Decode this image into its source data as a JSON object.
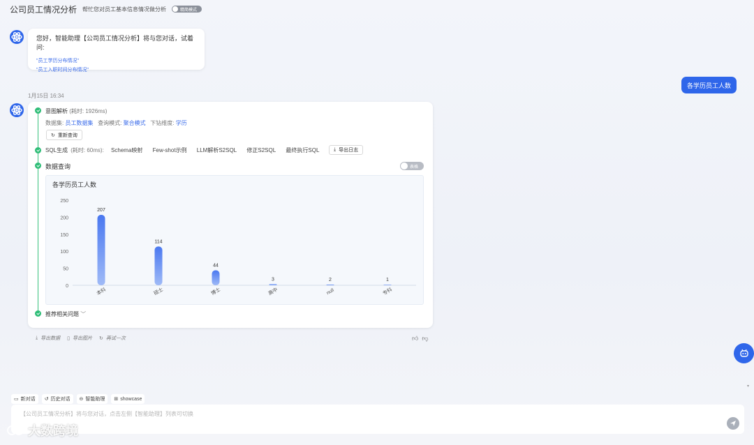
{
  "header": {
    "title": "公司员工情况分析",
    "subtitle": "帮忙您对员工基本信息情况做分析",
    "mode_toggle_label": "精简模式"
  },
  "greeting": {
    "text": "您好，智能助理【公司员工情况分析】将与您对话，试着问:",
    "suggestions": [
      "\"员工学历分布情况\"",
      "\"员工入职时间分布情况\""
    ]
  },
  "user_message": "各学历员工人数",
  "timestamp": "1月15日 16:34",
  "steps": {
    "intent": {
      "title": "意图解析",
      "elapsed": "(耗时: 1926ms)",
      "dataset_label": "数据集:",
      "dataset_value": "员工数据集",
      "query_mode_label": "查询模式:",
      "query_mode_value": "聚合模式",
      "drill_label": "下钻维度:",
      "drill_value": "学历",
      "requery_label": "重新查询"
    },
    "sql": {
      "title": "SQL生成",
      "elapsed": "(耗时: 60ms):",
      "tabs": [
        "Schema映射",
        "Few-shot示例",
        "LLM解析S2SQL",
        "修正S2SQL",
        "最终执行SQL"
      ],
      "export_log_label": "导出日志"
    },
    "query": {
      "title": "数据查询",
      "table_toggle_label": "表格"
    },
    "related_label": "推荐相关问题"
  },
  "chart_data": {
    "type": "bar",
    "title": "各学历员工人数",
    "categories": [
      "本科",
      "硕士",
      "博士",
      "高中",
      "null",
      "专科"
    ],
    "values": [
      207,
      114,
      44,
      3,
      2,
      1
    ],
    "yticks": [
      0,
      50,
      100,
      150,
      200,
      250
    ],
    "ylim": [
      0,
      250
    ],
    "bar_color_top": "#4a78f0",
    "bar_color_bottom": "#9fbaf7"
  },
  "actions": {
    "export_data": "导出数据",
    "export_image": "导出图片",
    "retry": "再试一次"
  },
  "bottom_tabs": [
    "新对话",
    "历史对话",
    "智能助理",
    "showcase"
  ],
  "input": {
    "placeholder": "【公司员工情况分析】将与您对话，点击左侧【智能助理】列表可切换"
  },
  "watermark": "大数跨境",
  "colors": {
    "accent": "#2f66ea",
    "success": "#2ebd77"
  }
}
